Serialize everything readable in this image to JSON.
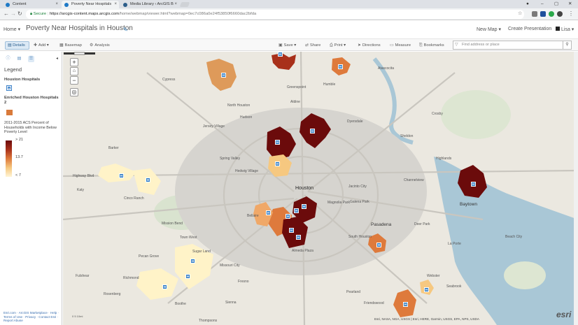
{
  "browser": {
    "tabs": [
      {
        "title": "Content",
        "active": false
      },
      {
        "title": "Poverty Near Hospitals",
        "active": true
      },
      {
        "title": "Media Library ‹ ArcGIS B",
        "active": false
      }
    ],
    "secure_label": "Secure",
    "url_host": "https://arcgis-content.maps.arcgis.com",
    "url_path": "/home/webmap/viewer.html?webmap=0ec7c086a0e24f53850f6660dac2bfda"
  },
  "header": {
    "home": "Home ▾",
    "title": "Poverty Near Hospitals in Houston",
    "new_map": "New Map ▾",
    "create_presentation": "Create Presentation",
    "user": "Lisa ▾"
  },
  "toolbar": {
    "details": "Details",
    "add": "Add ▾",
    "basemap": "Basemap",
    "analysis": "Analysis",
    "save": "Save ▾",
    "share": "Share",
    "print": "Print ▾",
    "directions": "Directions",
    "measure": "Measure",
    "bookmarks": "Bookmarks",
    "search_placeholder": "Find address or place"
  },
  "sidebar": {
    "legend_title": "Legend",
    "layer1": "Houston Hospitals",
    "layer2": "Enriched Houston Hospitals 2",
    "field": "2011-2015 ACS Percent of Households with Income Below Poverty Level",
    "ramp_labels": [
      "> 21",
      "13.7",
      "< 7"
    ],
    "footer": "Esri.com · ArcGIS Marketplace · Help · Terms of Use · Privacy · Contact Esri · Report Abuse"
  },
  "map": {
    "places": [
      {
        "name": "Houston",
        "cls": "big"
      },
      {
        "name": "Baytown",
        "cls": "city"
      },
      {
        "name": "Pasadena",
        "cls": "city"
      },
      {
        "name": "Cypress",
        "cls": ""
      },
      {
        "name": "Atascocita",
        "cls": ""
      },
      {
        "name": "Humble",
        "cls": ""
      },
      {
        "name": "Aldine",
        "cls": ""
      },
      {
        "name": "North Houston",
        "cls": ""
      },
      {
        "name": "Hudson",
        "cls": ""
      },
      {
        "name": "Jersey Village",
        "cls": ""
      },
      {
        "name": "Dyersdale",
        "cls": ""
      },
      {
        "name": "Sheldon",
        "cls": ""
      },
      {
        "name": "Crosby",
        "cls": ""
      },
      {
        "name": "Highlands",
        "cls": ""
      },
      {
        "name": "Channelview",
        "cls": ""
      },
      {
        "name": "Jacinto City",
        "cls": ""
      },
      {
        "name": "Galena Park",
        "cls": ""
      },
      {
        "name": "Magnolia Park",
        "cls": ""
      },
      {
        "name": "Deer Park",
        "cls": ""
      },
      {
        "name": "La Porte",
        "cls": ""
      },
      {
        "name": "Beach City",
        "cls": ""
      },
      {
        "name": "Mission Bend",
        "cls": ""
      },
      {
        "name": "Town West",
        "cls": ""
      },
      {
        "name": "Sugar Land",
        "cls": ""
      },
      {
        "name": "Missouri City",
        "cls": ""
      },
      {
        "name": "Pecan Grove",
        "cls": ""
      },
      {
        "name": "Richmond",
        "cls": ""
      },
      {
        "name": "Rosenberg",
        "cls": ""
      },
      {
        "name": "Cinco Ranch",
        "cls": ""
      },
      {
        "name": "Almeda Plaza",
        "cls": ""
      },
      {
        "name": "South Houston",
        "cls": ""
      },
      {
        "name": "Pearland",
        "cls": ""
      },
      {
        "name": "Friendswood",
        "cls": ""
      },
      {
        "name": "Seabrook",
        "cls": ""
      },
      {
        "name": "Fresno",
        "cls": ""
      },
      {
        "name": "Boothe",
        "cls": ""
      },
      {
        "name": "Thompsons",
        "cls": ""
      },
      {
        "name": "Webster",
        "cls": ""
      },
      {
        "name": "Bellaire",
        "cls": ""
      },
      {
        "name": "Hedwig Village",
        "cls": ""
      },
      {
        "name": "Spring Valley",
        "cls": ""
      },
      {
        "name": "Greenspoint",
        "cls": ""
      },
      {
        "name": "Fulshear",
        "cls": ""
      },
      {
        "name": "Katy",
        "cls": ""
      },
      {
        "name": "Barker",
        "cls": ""
      },
      {
        "name": "Highway Blvd",
        "cls": ""
      },
      {
        "name": "Sienna",
        "cls": ""
      }
    ],
    "scale_label": "0   5   10mi",
    "attribution": "Esri, NASA, NGA, USGS | Esri, HERE, Garmin, USGS, EPA, NPS, USDA",
    "esri_logo": "esri",
    "poverty_colors": {
      "high": "#6b0b0b",
      "midhigh": "#a8301a",
      "mid": "#de7a3c",
      "low": "#f6c880",
      "verylow": "#fff5d6"
    }
  }
}
